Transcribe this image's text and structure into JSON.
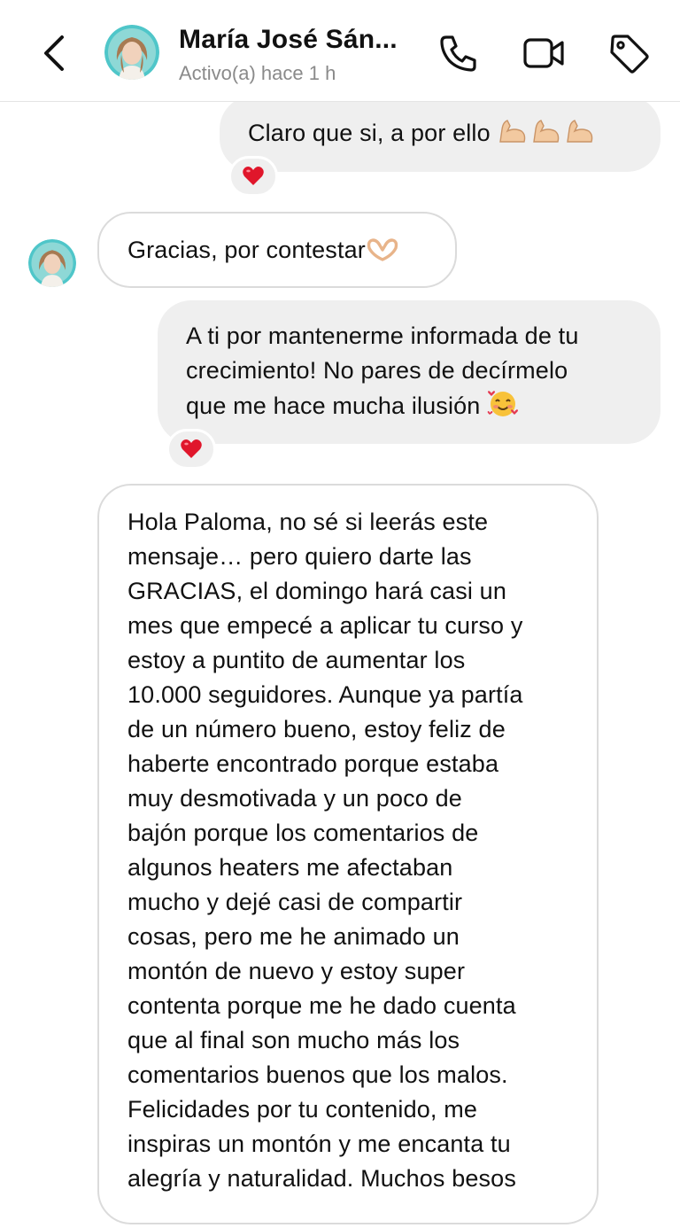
{
  "header": {
    "contact_name": "María José Sán...",
    "status": "Activo(a) hace 1 h"
  },
  "icons": [
    "back-arrow-icon",
    "avatar",
    "phone-icon",
    "video-camera-icon",
    "tag-icon",
    "heart-reaction-icon",
    "flexed-biceps-emoji",
    "heart-hands-emoji",
    "smiling-face-with-hearts-emoji"
  ],
  "colors": {
    "outgoing_bubble": "#efefef",
    "incoming_bubble_border": "#dbdbdb",
    "secondary_text": "#8a8a8a",
    "heart": "#e0162b"
  },
  "messages": [
    {
      "direction": "outgoing",
      "text": "Claro que si, a por ello",
      "emoji": "💪💪💪",
      "reaction": "❤️"
    },
    {
      "direction": "incoming",
      "text": "Gracias, por contestar",
      "emoji": "🫶"
    },
    {
      "direction": "outgoing",
      "lines": [
        "A ti por mantenerme informada de tu",
        "crecimiento! No pares de decírmelo",
        "que me hace mucha ilusión"
      ],
      "emoji": "🥰",
      "reaction": "❤️"
    },
    {
      "direction": "incoming",
      "lines": [
        "Hola Paloma, no sé si leerás este",
        "mensaje… pero quiero darte las",
        "GRACIAS, el domingo hará casi un",
        "mes que empecé a aplicar tu curso y",
        "estoy a puntito de aumentar los",
        "10.000 seguidores. Aunque ya partía",
        "de un número bueno, estoy feliz de",
        "haberte encontrado porque estaba",
        "muy desmotivada y un poco de",
        "bajón porque los comentarios de",
        "algunos heaters me afectaban",
        "mucho y dejé casi de compartir",
        "cosas, pero me he animado un",
        "montón de nuevo y estoy super",
        "contenta porque me he dado cuenta",
        "que al final son mucho más los",
        "comentarios buenos que los malos.",
        "Felicidades por tu contenido, me",
        "inspiras un montón y me encanta tu",
        "alegría y naturalidad. Muchos besos"
      ]
    }
  ]
}
